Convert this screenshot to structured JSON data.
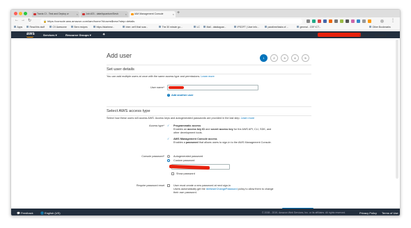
{
  "browser": {
    "tabs": [
      {
        "label": "Travis CI - Test and Deploy w",
        "color": "#c33"
      },
      {
        "label": "Job #23 - date/tquantum/Sesh",
        "color": "#c33"
      },
      {
        "label": "IAM Management Console",
        "color": "#f90"
      }
    ],
    "url": "https://console.aws.amazon.com/iam/home?#/users$new?step=details",
    "bookmarks": [
      "Apps",
      "Read this stuff",
      "CV Awesome",
      "Bern recipes",
      "https://startnew...",
      "Inter: we'll that scar...",
      "The 30 minute gu...",
      "LC",
      "Mail - datalaguar...",
      "IPSOFT | User info...",
      "paratime/tasks of ...",
      "general - CSF ICT..."
    ],
    "other_bookmarks": "Other Bookmarks"
  },
  "aws_nav": {
    "logo": "aws",
    "services": "Services",
    "resource_groups": "Resource Groups",
    "region": "Global",
    "support": "Support"
  },
  "page": {
    "title": "Add user",
    "steps": [
      "1",
      "2",
      "3",
      "4",
      "5"
    ],
    "active_step": 1,
    "set_details": {
      "heading": "Set user details",
      "description": "You can add multiple users at once with the same access type and permissions.",
      "learn_more": "Learn more",
      "username_label": "User name*",
      "add_another": "Add another user"
    },
    "access": {
      "heading": "Select AWS access type",
      "description": "Select how these users will access AWS. Access keys and autogenerated passwords are provided in the last step.",
      "learn_more": "Learn more",
      "access_type_label": "Access type*",
      "programmatic_title": "Programmatic access",
      "programmatic_desc_1": "Enables an",
      "programmatic_desc_key": "access key ID",
      "programmatic_desc_2": "and",
      "programmatic_desc_secret": "secret access key",
      "programmatic_desc_3": "for the AWS API, CLI, SDK, and",
      "programmatic_desc_4": "other development tools.",
      "console_title": "AWS Management Console access",
      "console_desc_1": "Enables a",
      "console_desc_password": "password",
      "console_desc_2": "that allows users to sign-in to the AWS Management Console.",
      "console_password_label": "Console password*",
      "autogenerated": "Autogenerated password",
      "custom": "Custom password",
      "show_password": "Show password",
      "reset_label": "Require password reset",
      "reset_desc_1": "User must create a new password at next sign-in",
      "reset_desc_2": "Users automatically get the",
      "reset_policy": "IAMUserChangePassword",
      "reset_desc_3": "policy to allow them to change",
      "reset_desc_4": "their own password."
    },
    "required_note": "* Required",
    "cancel": "Cancel",
    "next": "Next: Permissions"
  },
  "footer": {
    "feedback": "Feedback",
    "language": "English (US)",
    "copyright": "© 2008 - 2019, Amazon Web Services, Inc. or its affiliates. All rights reserved.",
    "privacy": "Privacy Policy",
    "terms": "Terms of Use"
  },
  "colors": {
    "aws_dark": "#232f3e",
    "accent": "#0073bb",
    "aws_orange": "#ff9900",
    "redaction": "#e8220d"
  }
}
